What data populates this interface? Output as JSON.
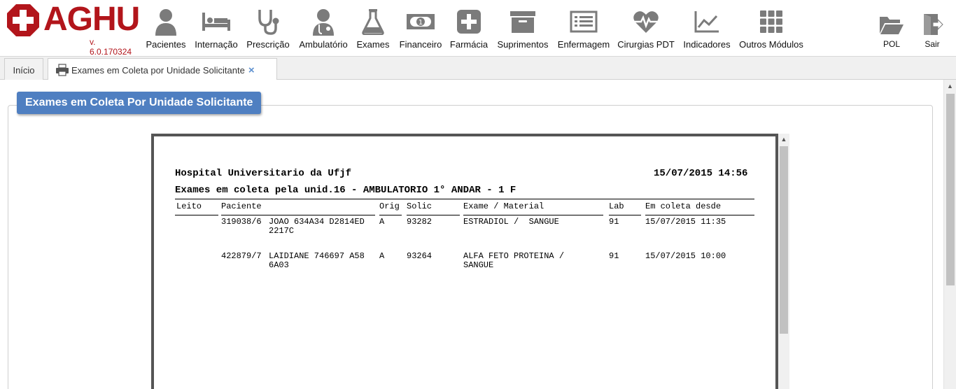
{
  "app": {
    "logo_text": "AGHU",
    "version": "v. 6.0.170324"
  },
  "nav": {
    "items": [
      {
        "label": "Pacientes",
        "icon": "patient-icon"
      },
      {
        "label": "Internação",
        "icon": "bed-icon"
      },
      {
        "label": "Prescrição",
        "icon": "stethoscope-icon"
      },
      {
        "label": "Ambulatório",
        "icon": "doctor-icon"
      },
      {
        "label": "Exames",
        "icon": "flask-icon"
      },
      {
        "label": "Financeiro",
        "icon": "money-icon"
      },
      {
        "label": "Farmácia",
        "icon": "plus-icon"
      },
      {
        "label": "Suprimentos",
        "icon": "archive-icon"
      },
      {
        "label": "Enfermagem",
        "icon": "list-icon"
      },
      {
        "label": "Cirurgias PDT",
        "icon": "heartbeat-icon"
      },
      {
        "label": "Indicadores",
        "icon": "line-chart-icon"
      },
      {
        "label": "Outros Módulos",
        "icon": "grid-icon"
      }
    ],
    "right": [
      {
        "label": "POL",
        "icon": "folder-icon"
      },
      {
        "label": "Sair",
        "icon": "sign-out-icon"
      }
    ]
  },
  "tabs": [
    {
      "label": "Início"
    },
    {
      "label": "Exames em Coleta por Unidade Solicitante",
      "close": "×",
      "icon": "printer-icon"
    }
  ],
  "panel": {
    "legend": "Exames em Coleta Por Unidade Solicitante"
  },
  "report": {
    "hospital": "Hospital Universitario da Ufjf",
    "datetime": "15/07/2015 14:56",
    "subtitle": "Exames em coleta pela unid.16 - AMBULATORIO 1° ANDAR - 1 F",
    "headers": {
      "leito": "Leito",
      "paciente": "Paciente",
      "orig": "Orig",
      "solic": "Solic",
      "exame": "Exame / Material",
      "lab": "Lab",
      "desde": "Em coleta desde"
    },
    "rows": [
      {
        "leito": "",
        "prontuario": "319038/6",
        "nome_1": "JOAO 634A34 D2814ED",
        "nome_2": "2217C",
        "orig": "A",
        "solic": "93282",
        "exame_1": "ESTRADIOL /  SANGUE",
        "exame_2": "",
        "lab": "91",
        "desde": "15/07/2015 11:35"
      },
      {
        "leito": "",
        "prontuario": "422879/7",
        "nome_1": "LAIDIANE 746697 A58",
        "nome_2": "6A03",
        "orig": "A",
        "solic": "93264",
        "exame_1": "ALFA FETO PROTEINA /",
        "exame_2": "SANGUE",
        "lab": "91",
        "desde": "15/07/2015 10:00"
      }
    ]
  },
  "colors": {
    "brand_red": "#b2151b",
    "legend_blue": "#4f7fc1",
    "icon_gray": "#7b7b7b",
    "tab_close_blue": "#5b8fcf"
  }
}
